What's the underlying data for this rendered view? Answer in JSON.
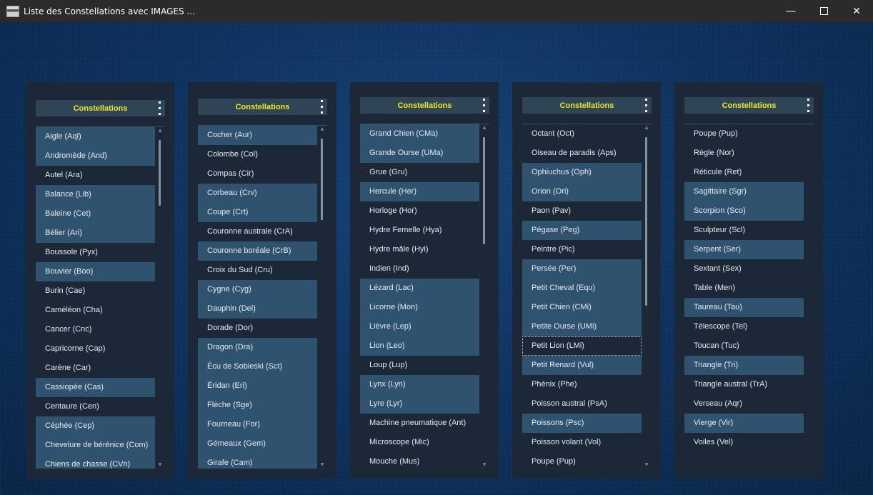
{
  "window": {
    "title": "Liste des Constellations avec IMAGES ...",
    "minimize_glyph": "—",
    "close_glyph": "✕"
  },
  "panels": [
    {
      "header": "Constellations",
      "items": [
        {
          "label": "Aigle (Aql)",
          "selected": true
        },
        {
          "label": "Andromède (And)",
          "selected": true
        },
        {
          "label": "Autel (Ara)",
          "selected": false
        },
        {
          "label": "Balance (Lib)",
          "selected": true
        },
        {
          "label": "Baleine (Cet)",
          "selected": true
        },
        {
          "label": "Bélier (Ari)",
          "selected": true
        },
        {
          "label": "Boussole (Pyx)",
          "selected": false
        },
        {
          "label": "Bouvier (Boo)",
          "selected": true
        },
        {
          "label": "Burin (Cae)",
          "selected": false
        },
        {
          "label": "Caméléon (Cha)",
          "selected": false
        },
        {
          "label": "Cancer (Cnc)",
          "selected": false
        },
        {
          "label": "Capricorne (Cap)",
          "selected": false
        },
        {
          "label": "Carène (Car)",
          "selected": false
        },
        {
          "label": "Cassiopée (Cas)",
          "selected": true
        },
        {
          "label": "Centaure (Cen)",
          "selected": false
        },
        {
          "label": "Céphée (Cep)",
          "selected": true
        },
        {
          "label": "Chevelure de bérénice (Com)",
          "selected": true
        },
        {
          "label": "Chiens de chasse (CVn)",
          "selected": true
        }
      ]
    },
    {
      "header": "Constellations",
      "items": [
        {
          "label": "Cocher (Aur)",
          "selected": true
        },
        {
          "label": "Colombe (Col)",
          "selected": false
        },
        {
          "label": "Compas (Cir)",
          "selected": false
        },
        {
          "label": "Corbeau (Crv)",
          "selected": true
        },
        {
          "label": "Coupe (Crt)",
          "selected": true
        },
        {
          "label": "Couronne australe (CrA)",
          "selected": false
        },
        {
          "label": "Couronne boréale (CrB)",
          "selected": true
        },
        {
          "label": "Croix du Sud (Cru)",
          "selected": false
        },
        {
          "label": "Cygne (Cyg)",
          "selected": true
        },
        {
          "label": "Dauphin (Del)",
          "selected": true
        },
        {
          "label": "Dorade (Dor)",
          "selected": false
        },
        {
          "label": "Dragon (Dra)",
          "selected": true
        },
        {
          "label": "Écu de Sobieski (Sct)",
          "selected": true
        },
        {
          "label": "Éridan (Eri)",
          "selected": true
        },
        {
          "label": "Flèche (Sge)",
          "selected": true
        },
        {
          "label": "Fourneau (For)",
          "selected": true
        },
        {
          "label": "Gémeaux (Gem)",
          "selected": true
        },
        {
          "label": "Girafe (Cam)",
          "selected": true
        }
      ]
    },
    {
      "header": "Constellations",
      "items": [
        {
          "label": "Grand Chien (CMa)",
          "selected": true
        },
        {
          "label": "Grande Ourse (UMa)",
          "selected": true
        },
        {
          "label": "Grue (Gru)",
          "selected": false
        },
        {
          "label": "Hercule (Her)",
          "selected": true
        },
        {
          "label": "Horloge (Hor)",
          "selected": false
        },
        {
          "label": "Hydre Femelle (Hya)",
          "selected": false
        },
        {
          "label": "Hydre mâle (Hyi)",
          "selected": false
        },
        {
          "label": "Indien (Ind)",
          "selected": false
        },
        {
          "label": "Lézard (Lac)",
          "selected": true
        },
        {
          "label": "Licorne (Mon)",
          "selected": true
        },
        {
          "label": "Lièvre (Lep)",
          "selected": true
        },
        {
          "label": "Lion (Leo)",
          "selected": true
        },
        {
          "label": "Loup (Lup)",
          "selected": false
        },
        {
          "label": "Lynx (Lyn)",
          "selected": true
        },
        {
          "label": "Lyre (Lyr)",
          "selected": true
        },
        {
          "label": "Machine pneumatique (Ant)",
          "selected": false
        },
        {
          "label": "Microscope (Mic)",
          "selected": false
        },
        {
          "label": "Mouche (Mus)",
          "selected": false
        }
      ]
    },
    {
      "header": "Constellations",
      "items": [
        {
          "label": "Octant (Oct)",
          "selected": false
        },
        {
          "label": "Oiseau de paradis (Aps)",
          "selected": false
        },
        {
          "label": "Ophiuchus (Oph)",
          "selected": true
        },
        {
          "label": "Orion (Ori)",
          "selected": true
        },
        {
          "label": "Paon (Pav)",
          "selected": false
        },
        {
          "label": "Pégase (Peg)",
          "selected": true
        },
        {
          "label": "Peintre (Pic)",
          "selected": false
        },
        {
          "label": "Persée (Per)",
          "selected": true
        },
        {
          "label": "Petit Cheval (Equ)",
          "selected": true
        },
        {
          "label": "Petit Chien (CMi)",
          "selected": true
        },
        {
          "label": "Petite Ourse (UMi)",
          "selected": true
        },
        {
          "label": "Petit Lion (LMi)",
          "selected": false,
          "focused": true
        },
        {
          "label": "Petit Renard (Vul)",
          "selected": true
        },
        {
          "label": "Phénix (Phe)",
          "selected": false
        },
        {
          "label": "Poisson austral (PsA)",
          "selected": false
        },
        {
          "label": "Poissons (Psc)",
          "selected": true
        },
        {
          "label": "Poisson volant (Vol)",
          "selected": false
        },
        {
          "label": "Poupe (Pup)",
          "selected": false
        }
      ]
    },
    {
      "header": "Constellations",
      "items": [
        {
          "label": "Poupe (Pup)",
          "selected": false
        },
        {
          "label": "Règle (Nor)",
          "selected": false
        },
        {
          "label": "Réticule (Ret)",
          "selected": false
        },
        {
          "label": "Sagittaire (Sgr)",
          "selected": true
        },
        {
          "label": "Scorpion (Sco)",
          "selected": true
        },
        {
          "label": "Sculpteur (Scl)",
          "selected": false
        },
        {
          "label": "Serpent (Ser)",
          "selected": true
        },
        {
          "label": "Sextant (Sex)",
          "selected": false
        },
        {
          "label": "Table (Men)",
          "selected": false
        },
        {
          "label": "Taureau (Tau)",
          "selected": true
        },
        {
          "label": "Télescope (Tel)",
          "selected": false
        },
        {
          "label": "Toucan (Tuc)",
          "selected": false
        },
        {
          "label": "Triangle (Tri)",
          "selected": true
        },
        {
          "label": "Triangle austral (TrA)",
          "selected": false
        },
        {
          "label": "Verseau (Aqr)",
          "selected": false
        },
        {
          "label": "Vierge (Vir)",
          "selected": true
        },
        {
          "label": "Voiles (Vel)",
          "selected": false
        }
      ]
    }
  ]
}
